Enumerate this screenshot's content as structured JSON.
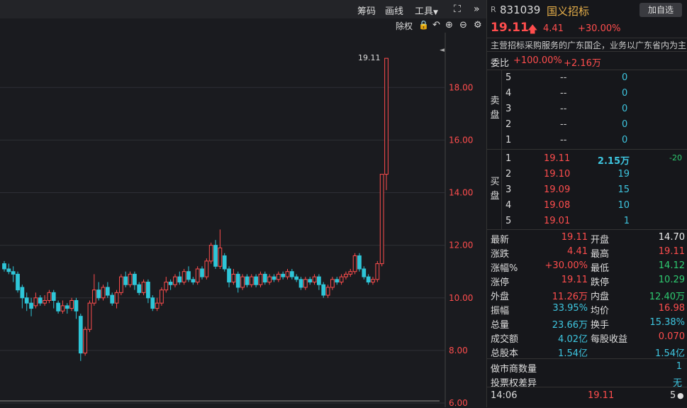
{
  "toolbar": {
    "chouma_label": "筹码",
    "draw_label": "画线",
    "tools_label": "工具",
    "chuquan_label": "除权"
  },
  "chart": {
    "peak_label": "19.11",
    "y_ticks": [
      "18.00",
      "16.00",
      "14.00",
      "12.00",
      "10.00",
      "8.00",
      "6.00"
    ]
  },
  "chart_data": {
    "type": "candlestick",
    "ylim": [
      6,
      19.6
    ],
    "y_ticks": [
      6,
      8,
      10,
      12,
      14,
      16,
      18
    ],
    "candles": [
      [
        11.3,
        11.1,
        11.4,
        11.0
      ],
      [
        11.1,
        11.0,
        11.3,
        10.9
      ],
      [
        11.0,
        10.9,
        11.2,
        10.6
      ],
      [
        10.9,
        10.3,
        11.0,
        10.2
      ],
      [
        10.4,
        10.0,
        10.5,
        9.6
      ],
      [
        10.0,
        9.8,
        10.2,
        9.5
      ],
      [
        9.8,
        9.6,
        10.0,
        9.3
      ],
      [
        9.7,
        10.0,
        10.2,
        9.6
      ],
      [
        10.0,
        9.8,
        10.1,
        9.7
      ],
      [
        9.8,
        9.9,
        10.1,
        9.7
      ],
      [
        9.9,
        10.2,
        10.3,
        9.8
      ],
      [
        10.2,
        9.9,
        10.3,
        9.6
      ],
      [
        9.8,
        9.5,
        9.9,
        9.4
      ],
      [
        9.5,
        9.7,
        9.9,
        9.4
      ],
      [
        9.7,
        9.6,
        9.8,
        9.4
      ],
      [
        9.6,
        9.9,
        10.0,
        9.5
      ],
      [
        9.9,
        9.5,
        10.0,
        9.2
      ],
      [
        9.3,
        7.9,
        9.4,
        7.6
      ],
      [
        7.9,
        8.8,
        8.9,
        7.8
      ],
      [
        8.8,
        9.8,
        9.9,
        8.7
      ],
      [
        9.8,
        10.3,
        10.9,
        9.7
      ],
      [
        10.3,
        10.0,
        10.6,
        9.9
      ],
      [
        10.0,
        10.4,
        10.5,
        9.9
      ],
      [
        10.4,
        10.1,
        10.6,
        10.0
      ],
      [
        10.1,
        9.8,
        10.2,
        9.7
      ],
      [
        9.8,
        10.2,
        10.3,
        9.6
      ],
      [
        10.2,
        10.8,
        10.9,
        10.1
      ],
      [
        10.8,
        10.5,
        11.0,
        10.4
      ],
      [
        10.5,
        10.9,
        11.0,
        10.4
      ],
      [
        10.9,
        10.5,
        11.0,
        10.3
      ],
      [
        10.5,
        10.2,
        10.6,
        10.1
      ],
      [
        10.2,
        10.6,
        10.7,
        10.1
      ],
      [
        10.6,
        10.0,
        10.7,
        9.8
      ],
      [
        10.0,
        9.6,
        10.1,
        9.5
      ],
      [
        9.6,
        9.8,
        10.0,
        9.5
      ],
      [
        9.8,
        10.3,
        10.4,
        9.7
      ],
      [
        10.3,
        10.6,
        10.8,
        10.2
      ],
      [
        10.6,
        10.5,
        10.7,
        10.3
      ],
      [
        10.5,
        10.8,
        10.9,
        10.4
      ],
      [
        10.8,
        10.6,
        11.0,
        10.5
      ],
      [
        10.6,
        11.0,
        11.1,
        10.5
      ],
      [
        11.0,
        10.7,
        11.2,
        10.6
      ],
      [
        10.7,
        10.6,
        10.8,
        10.5
      ],
      [
        10.6,
        11.1,
        11.2,
        10.5
      ],
      [
        11.1,
        10.8,
        11.2,
        10.7
      ],
      [
        10.8,
        11.4,
        11.5,
        10.7
      ],
      [
        11.4,
        12.0,
        12.1,
        11.3
      ],
      [
        12.0,
        11.2,
        12.2,
        11.1
      ],
      [
        11.2,
        11.9,
        12.6,
        11.1
      ],
      [
        11.6,
        11.1,
        11.7,
        11.0
      ],
      [
        11.1,
        10.6,
        11.2,
        10.4
      ],
      [
        10.6,
        10.9,
        11.1,
        10.5
      ],
      [
        10.9,
        10.4,
        11.0,
        10.2
      ],
      [
        10.4,
        10.8,
        10.9,
        10.3
      ],
      [
        10.8,
        10.5,
        10.9,
        10.4
      ],
      [
        10.5,
        10.8,
        10.9,
        10.4
      ],
      [
        10.8,
        10.5,
        10.9,
        10.4
      ],
      [
        10.5,
        10.9,
        11.0,
        10.4
      ],
      [
        10.9,
        10.6,
        11.0,
        10.5
      ],
      [
        10.6,
        10.8,
        10.9,
        10.5
      ],
      [
        10.8,
        10.7,
        10.9,
        10.6
      ],
      [
        10.7,
        10.9,
        11.0,
        10.6
      ],
      [
        10.9,
        10.8,
        11.0,
        10.7
      ],
      [
        10.8,
        11.0,
        11.1,
        10.7
      ],
      [
        11.0,
        10.8,
        11.1,
        10.7
      ],
      [
        10.8,
        10.7,
        10.9,
        10.6
      ],
      [
        10.7,
        10.4,
        10.8,
        10.3
      ],
      [
        10.4,
        10.7,
        10.8,
        10.3
      ],
      [
        10.7,
        10.6,
        10.8,
        10.5
      ],
      [
        10.6,
        10.8,
        10.9,
        10.5
      ],
      [
        10.8,
        10.5,
        10.9,
        10.3
      ],
      [
        10.5,
        10.1,
        10.6,
        10.0
      ],
      [
        10.1,
        10.4,
        10.5,
        10.0
      ],
      [
        10.4,
        10.7,
        10.8,
        10.3
      ],
      [
        10.7,
        10.6,
        10.8,
        10.5
      ],
      [
        10.6,
        10.8,
        10.9,
        10.5
      ],
      [
        10.8,
        10.9,
        11.0,
        10.7
      ],
      [
        10.9,
        11.0,
        11.1,
        10.8
      ],
      [
        11.0,
        11.6,
        11.7,
        10.9
      ],
      [
        11.6,
        11.1,
        11.7,
        11.0
      ],
      [
        11.1,
        10.8,
        11.2,
        10.7
      ],
      [
        10.8,
        10.6,
        10.9,
        10.5
      ],
      [
        10.6,
        10.7,
        10.8,
        10.5
      ],
      [
        10.7,
        11.3,
        11.4,
        10.6
      ],
      [
        11.3,
        14.7,
        14.7,
        11.2
      ],
      [
        14.7,
        19.11,
        19.11,
        14.1
      ]
    ]
  },
  "stock": {
    "r_tag": "R",
    "code": "831039",
    "name": "国义招标",
    "add_button": "加自选",
    "price": "19.11",
    "change": "4.41",
    "change_pct": "+30.00%",
    "description": "主营招标采购服务的广东国企，业务以广东省内为主"
  },
  "webi": {
    "label": "委比",
    "value1": "+100.00%",
    "value2": "+2.16万"
  },
  "orderbook": {
    "sell_label": "卖盘",
    "buy_label": "买盘",
    "sells": [
      {
        "level": "5",
        "price": "--",
        "vol": "0"
      },
      {
        "level": "4",
        "price": "--",
        "vol": "0"
      },
      {
        "level": "3",
        "price": "--",
        "vol": "0"
      },
      {
        "level": "2",
        "price": "--",
        "vol": "0"
      },
      {
        "level": "1",
        "price": "--",
        "vol": "0"
      }
    ],
    "buys": [
      {
        "level": "1",
        "price": "19.11",
        "vol": "2.15万",
        "diff": "-20"
      },
      {
        "level": "2",
        "price": "19.10",
        "vol": "19",
        "diff": ""
      },
      {
        "level": "3",
        "price": "19.09",
        "vol": "15",
        "diff": ""
      },
      {
        "level": "4",
        "price": "19.08",
        "vol": "10",
        "diff": ""
      },
      {
        "level": "5",
        "price": "19.01",
        "vol": "1",
        "diff": ""
      }
    ]
  },
  "stats": [
    {
      "l1": "最新",
      "v1": "19.11",
      "c1": "red",
      "l2": "开盘",
      "v2": "14.70",
      "c2": "white"
    },
    {
      "l1": "涨跌",
      "v1": "4.41",
      "c1": "red",
      "l2": "最高",
      "v2": "19.11",
      "c2": "red"
    },
    {
      "l1": "涨幅%",
      "v1": "+30.00%",
      "c1": "red",
      "l2": "最低",
      "v2": "14.12",
      "c2": "green"
    },
    {
      "l1": "涨停",
      "v1": "19.11",
      "c1": "red",
      "l2": "跌停",
      "v2": "10.29",
      "c2": "green"
    },
    {
      "l1": "外盘",
      "v1": "11.26万",
      "c1": "red",
      "l2": "内盘",
      "v2": "12.40万",
      "c2": "green"
    },
    {
      "l1": "振幅",
      "v1": "33.95%",
      "c1": "cyan",
      "l2": "均价",
      "v2": "16.98",
      "c2": "red"
    },
    {
      "l1": "总量",
      "v1": "23.66万",
      "c1": "cyan",
      "l2": "换手",
      "v2": "15.38%",
      "c2": "cyan"
    },
    {
      "l1": "成交额",
      "v1": "4.02亿",
      "c1": "cyan",
      "l2": "每股收益",
      "v2": "0.070",
      "c2": "red"
    },
    {
      "l1": "总股本",
      "v1": "1.54亿",
      "c1": "cyan",
      "l2": "",
      "v2": "1.54亿",
      "c2": "cyan"
    }
  ],
  "market_maker": {
    "count_label": "做市商数量",
    "count_value": "1",
    "vote_label": "投票权差异",
    "vote_value": "无"
  },
  "tick": {
    "time": "14:06",
    "price": "19.11",
    "vol": "5"
  }
}
